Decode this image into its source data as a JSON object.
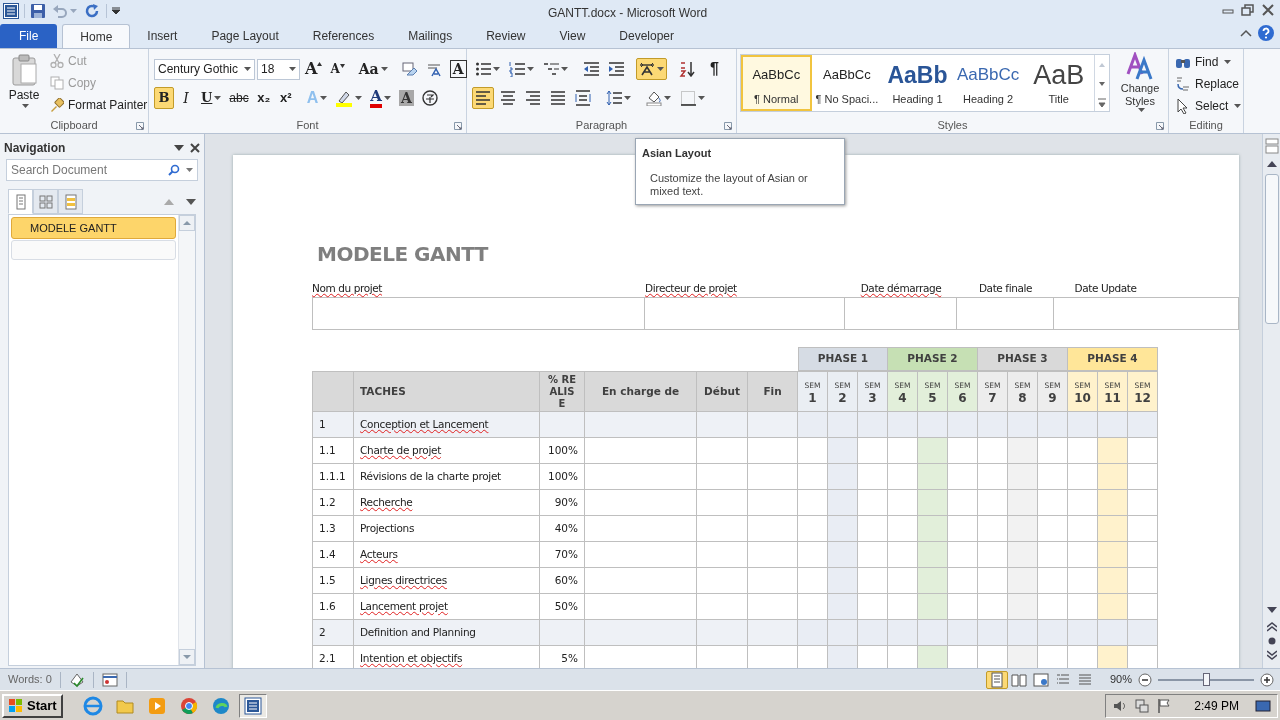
{
  "window": {
    "title": "GANTT.docx - Microsoft Word"
  },
  "ribbon_tabs": [
    {
      "label": "File",
      "kind": "file",
      "selected": false
    },
    {
      "label": "Home",
      "kind": "tab",
      "selected": true
    },
    {
      "label": "Insert",
      "kind": "tab",
      "selected": false
    },
    {
      "label": "Page Layout",
      "kind": "tab",
      "selected": false
    },
    {
      "label": "References",
      "kind": "tab",
      "selected": false
    },
    {
      "label": "Mailings",
      "kind": "tab",
      "selected": false
    },
    {
      "label": "Review",
      "kind": "tab",
      "selected": false
    },
    {
      "label": "View",
      "kind": "tab",
      "selected": false
    },
    {
      "label": "Developer",
      "kind": "tab",
      "selected": false
    }
  ],
  "clipboard": {
    "label": "Clipboard",
    "paste": "Paste",
    "cut": {
      "label": "Cut",
      "disabled": true
    },
    "copy": {
      "label": "Copy",
      "disabled": true
    },
    "format_painter": {
      "label": "Format Painter",
      "disabled": false
    }
  },
  "font": {
    "label": "Font",
    "font_name": "Century Gothic",
    "font_size": "18",
    "row1": [
      {
        "kind": "grow",
        "label": "A"
      },
      {
        "kind": "shrink",
        "label": "A"
      },
      {
        "kind": "case",
        "label": "Aa"
      },
      {
        "kind": "clear"
      },
      {
        "kind": "phonetic"
      },
      {
        "kind": "border",
        "label": "A"
      }
    ],
    "row2": [
      {
        "kind": "bold",
        "label": "B",
        "selected": true
      },
      {
        "kind": "italic",
        "label": "I",
        "selected": false
      },
      {
        "kind": "underline",
        "label": "U",
        "selected": false
      },
      {
        "kind": "strike",
        "label": "abc",
        "selected": false
      },
      {
        "kind": "sub",
        "label": "x₂",
        "selected": false
      },
      {
        "kind": "sup",
        "label": "x²",
        "selected": false
      },
      {
        "kind": "effects",
        "label": "A"
      },
      {
        "kind": "highlight"
      },
      {
        "kind": "color",
        "label": "A"
      },
      {
        "kind": "shading",
        "label": "A"
      },
      {
        "kind": "enclose"
      }
    ]
  },
  "paragraph": {
    "label": "Paragraph",
    "row1": [
      {
        "kind": "bullets",
        "selected": false
      },
      {
        "kind": "numbering",
        "selected": false
      },
      {
        "kind": "multilevel",
        "selected": false
      },
      {
        "kind": "outdent",
        "selected": false
      },
      {
        "kind": "indent",
        "selected": false
      },
      {
        "kind": "asian",
        "selected": true
      },
      {
        "kind": "sort",
        "selected": false
      },
      {
        "kind": "marks",
        "label": "¶",
        "selected": false
      }
    ],
    "row2": [
      {
        "kind": "left",
        "selected": true
      },
      {
        "kind": "center",
        "selected": false
      },
      {
        "kind": "right",
        "selected": false
      },
      {
        "kind": "justify",
        "selected": false
      },
      {
        "kind": "distribute",
        "selected": false
      },
      {
        "kind": "spacing",
        "selected": false
      },
      {
        "kind": "fill",
        "selected": false
      },
      {
        "kind": "borders",
        "selected": false
      }
    ]
  },
  "styles": {
    "label": "Styles",
    "items": [
      {
        "preview": "AaBbCc",
        "label": "¶ Normal",
        "kind": "normal",
        "selected": true
      },
      {
        "preview": "AaBbCc",
        "label": "¶ No Spaci...",
        "kind": "normal",
        "selected": false
      },
      {
        "preview": "AaBb",
        "label": "Heading 1",
        "kind": "heading1",
        "selected": false
      },
      {
        "preview": "AaBbCc",
        "label": "Heading 2",
        "kind": "heading2",
        "selected": false
      },
      {
        "preview": "AaB",
        "label": "Title",
        "kind": "title",
        "selected": false
      }
    ],
    "change_styles": "Change Styles"
  },
  "editing": {
    "label": "Editing",
    "items": [
      {
        "label": "Find",
        "kind": "find"
      },
      {
        "label": "Replace",
        "kind": "replace"
      },
      {
        "label": "Select",
        "kind": "select"
      }
    ]
  },
  "tooltip": {
    "title": "Asian Layout",
    "body": "Customize the layout of Asian or mixed text."
  },
  "navigation": {
    "title": "Navigation",
    "search_placeholder": "Search Document",
    "view_tabs": [
      {
        "kind": "headings",
        "selected": true
      },
      {
        "kind": "pages",
        "selected": false
      },
      {
        "kind": "results",
        "selected": false
      }
    ],
    "headings": [
      {
        "label": "MODELE GANTT",
        "selected": true
      }
    ]
  },
  "document": {
    "title": "MODELE GANTT",
    "project_fields": [
      {
        "label": "Nom du projet",
        "spell_error": true
      },
      {
        "label": "Directeur de projet",
        "spell_error": true
      },
      {
        "label": "Date démarrage",
        "spell_error": true
      },
      {
        "label": "Date finale",
        "spell_error": false
      },
      {
        "label": "Date Update",
        "spell_error": false
      }
    ],
    "columns": [
      "TACHES",
      "% REALISE",
      "En charge de",
      "Début",
      "Fin"
    ],
    "phases": [
      {
        "label": "PHASE 1",
        "color": "#d6dce4"
      },
      {
        "label": "PHASE 2",
        "color": "#c6e0b4"
      },
      {
        "label": "PHASE 3",
        "color": "#d9d9d9"
      },
      {
        "label": "PHASE 4",
        "color": "#ffe699"
      }
    ],
    "weeks": [
      {
        "label": "SEM",
        "number": "1"
      },
      {
        "label": "SEM",
        "number": "2"
      },
      {
        "label": "SEM",
        "number": "3"
      },
      {
        "label": "SEM",
        "number": "4"
      },
      {
        "label": "SEM",
        "number": "5"
      },
      {
        "label": "SEM",
        "number": "6"
      },
      {
        "label": "SEM",
        "number": "7"
      },
      {
        "label": "SEM",
        "number": "8"
      },
      {
        "label": "SEM",
        "number": "9"
      },
      {
        "label": "SEM",
        "number": "10"
      },
      {
        "label": "SEM",
        "number": "11"
      },
      {
        "label": "SEM",
        "number": "12"
      }
    ],
    "rows": [
      {
        "number": "1",
        "task": "Conception et  Lancement",
        "kind": "group",
        "spell_error": true
      },
      {
        "number": "1.1",
        "task": "Charte de projet",
        "percent": "100%",
        "kind": "task",
        "spell_error": true
      },
      {
        "number": "1.1.1",
        "task": "Révisions de la charte projet",
        "percent": "100%",
        "kind": "task",
        "spell_error": false
      },
      {
        "number": "1.2",
        "task": "Recherche",
        "percent": "90%",
        "kind": "task",
        "spell_error": true
      },
      {
        "number": "1.3",
        "task": "Projections",
        "percent": "40%",
        "kind": "task",
        "spell_error": false
      },
      {
        "number": "1.4",
        "task": "Acteurs",
        "percent": "70%",
        "kind": "task",
        "spell_error": true
      },
      {
        "number": "1.5",
        "task": "Lignes directrices",
        "percent": "60%",
        "kind": "task",
        "spell_error": true
      },
      {
        "number": "1.6",
        "task": "Lancement projet",
        "percent": "50%",
        "kind": "task",
        "spell_error": true
      },
      {
        "number": "2",
        "task": "Definition and Planning",
        "kind": "group",
        "spell_error": false
      },
      {
        "number": "2.1",
        "task": "Intention et objectifs",
        "percent": "5%",
        "kind": "task",
        "spell_error": true
      }
    ]
  },
  "status_bar": {
    "words": "Words: 0",
    "views": [
      {
        "kind": "print",
        "selected": true
      },
      {
        "kind": "reading",
        "selected": false
      },
      {
        "kind": "web",
        "selected": false
      },
      {
        "kind": "outline",
        "selected": false
      },
      {
        "kind": "draft",
        "selected": false
      }
    ],
    "zoom": "90%",
    "zoom_slider": {
      "level": 0.5
    }
  },
  "taskbar": {
    "start": "Start",
    "apps": [
      {
        "kind": "ie",
        "selected": false
      },
      {
        "kind": "folder",
        "selected": false
      },
      {
        "kind": "media",
        "selected": false
      },
      {
        "kind": "chrome",
        "selected": false
      },
      {
        "kind": "edge",
        "selected": false
      },
      {
        "kind": "word",
        "selected": true
      }
    ],
    "clock": "2:49 PM"
  }
}
